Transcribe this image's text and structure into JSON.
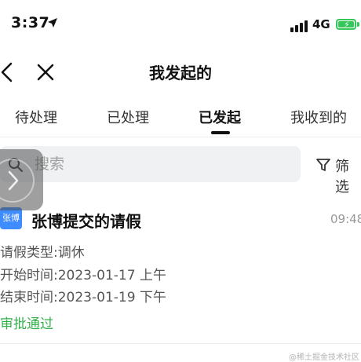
{
  "status_bar": {
    "time": "3:37",
    "network": "4G",
    "icons": [
      "location-arrow-icon",
      "signal-bars-icon",
      "battery-charging-icon"
    ]
  },
  "nav": {
    "title": "我发起的",
    "icons": [
      "back-icon",
      "close-icon"
    ]
  },
  "tabs": [
    {
      "label": "待处理",
      "active": false
    },
    {
      "label": "已处理",
      "active": false
    },
    {
      "label": "已发起",
      "active": true
    },
    {
      "label": "我收到的",
      "active": false
    }
  ],
  "search": {
    "placeholder": "搜索",
    "value": "",
    "filter_label": "筛选"
  },
  "list": [
    {
      "avatar_text": "张博",
      "title": "张博提交的请假",
      "time": "09:48",
      "details": [
        "请假类型:调休",
        "开始时间:2023-01-17 上午",
        "结束时间:2023-01-19 下午"
      ],
      "status": "审批通过"
    }
  ],
  "watermark": "@稀土掘金技术社区",
  "colors": {
    "accent": "#3f8cff",
    "approved": "#33b04a",
    "battery": "#34c759",
    "search_bg": "#f0f1f3"
  }
}
